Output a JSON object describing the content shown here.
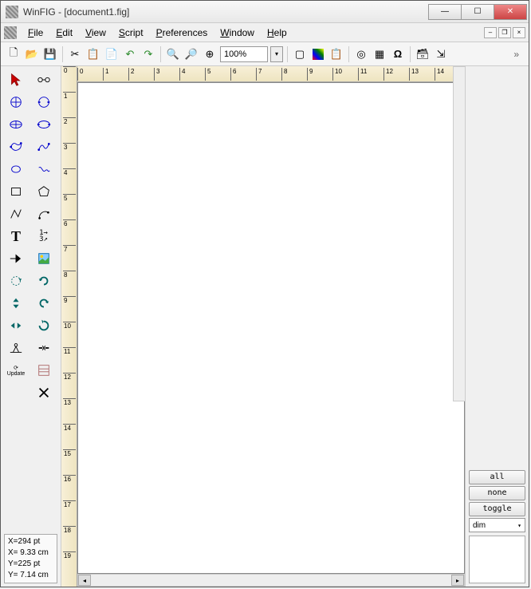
{
  "window": {
    "title": "WinFIG - [document1.fig]"
  },
  "menu": {
    "file": "File",
    "edit": "Edit",
    "view": "View",
    "script": "Script",
    "preferences": "Preferences",
    "window": "Window",
    "help": "Help"
  },
  "toolbar": {
    "zoom": "100%",
    "overflow": "»"
  },
  "coords": {
    "line1": "X=294 pt",
    "line2": "X= 9.33 cm",
    "line3": "Y=225 pt",
    "line4": "Y= 7.14 cm"
  },
  "ruler": {
    "h": [
      "0",
      "1",
      "2",
      "3",
      "4",
      "5",
      "6",
      "7",
      "8",
      "9",
      "10",
      "11",
      "12",
      "13",
      "14"
    ],
    "v": [
      "0",
      "1",
      "2",
      "3",
      "4",
      "5",
      "6",
      "7",
      "8",
      "9",
      "10",
      "11",
      "12",
      "13",
      "14",
      "15",
      "16",
      "17",
      "18",
      "19"
    ]
  },
  "right": {
    "all": "all",
    "none": "none",
    "toggle": "toggle",
    "dim": "dim"
  },
  "tool_labels": {
    "update": "Update"
  }
}
